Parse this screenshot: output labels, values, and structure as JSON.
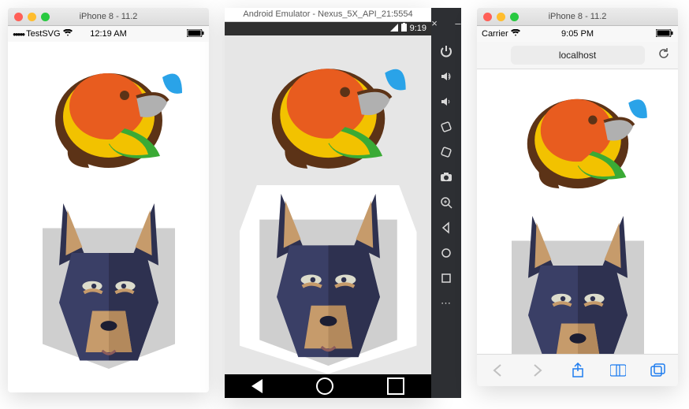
{
  "ios_sim": {
    "window_title": "iPhone 8 - 11.2",
    "app_name": "TestSVG",
    "time": "12:19 AM",
    "carrier_signal_icon": "●●●●●",
    "wifi_icon": "wifi",
    "battery_icon": "battery"
  },
  "android_emu": {
    "window_title": "Android Emulator - Nexus_5X_API_21:5554",
    "time": "9:19",
    "status_icons": {
      "cellular": "cellular",
      "battery": "battery"
    },
    "nav": {
      "back": "back",
      "home": "home",
      "recent": "recent"
    },
    "toolbar": {
      "close": "×",
      "minimize": "–",
      "items": [
        {
          "name": "power-icon",
          "label": "Power"
        },
        {
          "name": "volume-up-icon",
          "label": "Volume up"
        },
        {
          "name": "volume-down-icon",
          "label": "Volume down"
        },
        {
          "name": "rotate-left-icon",
          "label": "Rotate left"
        },
        {
          "name": "rotate-right-icon",
          "label": "Rotate right"
        },
        {
          "name": "camera-icon",
          "label": "Screenshot"
        },
        {
          "name": "zoom-icon",
          "label": "Zoom"
        },
        {
          "name": "back-icon",
          "label": "Back"
        },
        {
          "name": "home-icon",
          "label": "Home"
        },
        {
          "name": "recent-icon",
          "label": "Overview"
        },
        {
          "name": "more-icon",
          "label": "More"
        }
      ]
    }
  },
  "ios_safari": {
    "window_title": "iPhone 8 - 11.2",
    "carrier": "Carrier",
    "time": "9:05 PM",
    "url": "localhost",
    "toolbar": {
      "back": "back",
      "forward": "forward",
      "share": "share",
      "bookmarks": "bookmarks",
      "tabs": "tabs"
    }
  },
  "images": {
    "bird": "parrot-illustration",
    "dog": "doberman-illustration"
  }
}
